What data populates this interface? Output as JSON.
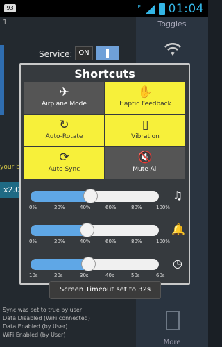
{
  "statusbar": {
    "badge": "93",
    "signal_label": "E",
    "time": "01:04"
  },
  "background": {
    "row_number": "1",
    "toggles_title": "Toggles",
    "service_label": "Service:",
    "service_state": "ON",
    "yellow_text": "your b",
    "multiplier": "x2.0",
    "log_lines": [
      "Sync was set to true by user",
      "Data Disabled (WiFi connected)",
      "Data Enabled (by User)",
      "WiFi Enabled (by User)"
    ],
    "more_label": "More"
  },
  "dialog": {
    "title": "Shortcuts",
    "tiles": [
      {
        "label": "Airplane Mode",
        "icon": "airplane-icon",
        "state": "off"
      },
      {
        "label": "Haptic Feedback",
        "icon": "hand-icon",
        "state": "on"
      },
      {
        "label": "Auto-Rotate",
        "icon": "rotate-icon",
        "state": "on"
      },
      {
        "label": "Vibration",
        "icon": "vibration-icon",
        "state": "on"
      },
      {
        "label": "Auto Sync",
        "icon": "sync-icon",
        "state": "on"
      },
      {
        "label": "Mute All",
        "icon": "mute-icon",
        "state": "off"
      }
    ],
    "sliders": [
      {
        "name": "media-volume",
        "icon": "music-note-icon",
        "value": 0.47,
        "ticks": [
          "0%",
          "20%",
          "40%",
          "60%",
          "80%",
          "100%"
        ]
      },
      {
        "name": "ringer-volume",
        "icon": "bell-icon",
        "value": 0.44,
        "ticks": [
          "0%",
          "20%",
          "40%",
          "60%",
          "80%",
          "100%"
        ]
      },
      {
        "name": "screen-timeout",
        "icon": "timer-icon",
        "value": 0.45,
        "ticks": [
          "10s",
          "20s",
          "30s",
          "40s",
          "50s",
          "60s"
        ]
      }
    ]
  },
  "toast": {
    "text": "Screen Timeout set to 32s"
  },
  "colors": {
    "accent": "#33b5e5",
    "tile_on": "#f7f03a",
    "tile_off": "#555555",
    "slider_fill": "#5fa7e6"
  }
}
